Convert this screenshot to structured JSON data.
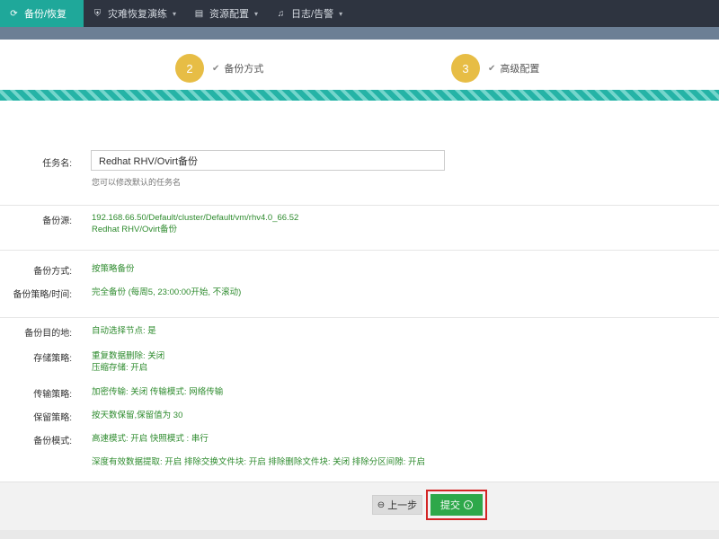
{
  "nav": {
    "items": [
      {
        "icon": "refresh-icon",
        "label": "备份/恢复",
        "active": true
      },
      {
        "icon": "shield-icon",
        "label": "灾难恢复演练",
        "active": false
      },
      {
        "icon": "server-icon",
        "label": "资源配置",
        "active": false
      },
      {
        "icon": "bell-icon",
        "label": "日志/告警",
        "active": false
      }
    ]
  },
  "steps": [
    {
      "number": "2",
      "label": "备份方式"
    },
    {
      "number": "3",
      "label": "高级配置"
    }
  ],
  "form": {
    "task_name_label": "任务名:",
    "task_name_value": "Redhat RHV/Ovirt备份",
    "task_name_hint": "您可以修改默认的任务名",
    "source_label": "备份源:",
    "source_path": "192.168.66.50/Default/cluster/Default/vm/rhv4.0_66.52",
    "source_type": "Redhat RHV/Ovirt备份",
    "method_label": "备份方式:",
    "method_value": "按策略备份",
    "policy_label": "备份策略/时间:",
    "policy_value": "完全备份 (每周5, 23:00:00开始, 不滚动)",
    "dest_label": "备份目的地:",
    "dest_value": "自动选择节点: 是",
    "storage_label": "存储策略:",
    "storage_value_1": "重复数据删除: 关闭",
    "storage_value_2": "压缩存储: 开启",
    "transfer_label": "传输策略:",
    "transfer_value": "加密传输: 关闭 传输模式: 网络传输",
    "retention_label": "保留策略:",
    "retention_value": "按天数保留,保留值为 30",
    "mode_label": "备份模式:",
    "mode_value": "高速模式: 开启 快照模式 : 串行",
    "deep_value": "深度有效数据提取: 开启 排除交换文件块: 开启 排除删除文件块: 关闭 排除分区间隙: 开启"
  },
  "footer": {
    "prev_label": "上一步",
    "submit_label": "提交"
  },
  "colors": {
    "nav_bg": "#2e3440",
    "nav_active": "#1fa89a",
    "step_circle": "#e7bd45",
    "value_green": "#2e8b2e",
    "submit_green": "#2ea84a",
    "highlight_red": "#d32424"
  }
}
